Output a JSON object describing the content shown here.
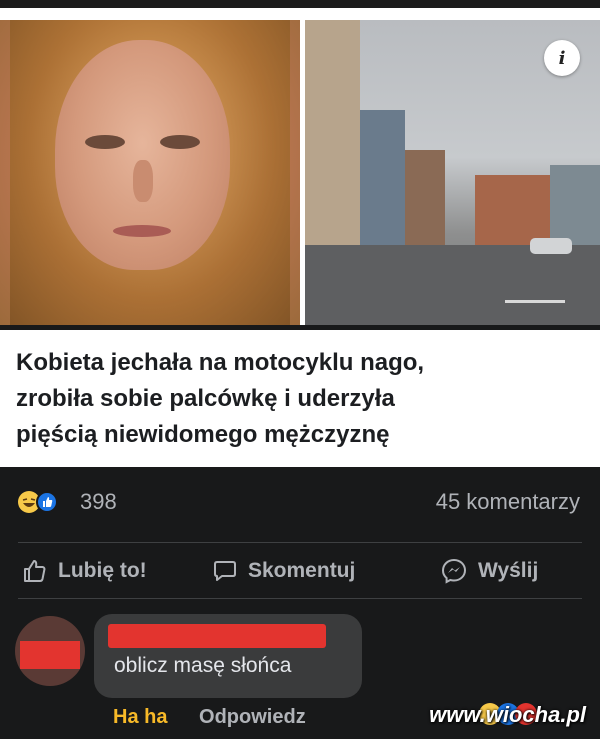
{
  "photos": {
    "info_icon": "info-icon",
    "info_label": "i"
  },
  "headline": {
    "lines": [
      "Kobieta jechała na motocyklu nago,",
      "zrobiła sobie palcówkę i uderzyła",
      "pięścią niewidomego mężczyznę"
    ]
  },
  "stats": {
    "reaction_icons": [
      "haha-icon",
      "like-icon"
    ],
    "reaction_count": "398",
    "comment_count": "45 komentarzy"
  },
  "actions": {
    "like": "Lubię to!",
    "comment": "Skomentuj",
    "send": "Wyślij"
  },
  "comment": {
    "text": "oblicz masę słońca",
    "haha_label": "Ha ha",
    "reply_label": "Odpowiedz"
  },
  "watermark": "www.wiocha.pl",
  "colors": {
    "background": "#18191a",
    "bubble": "#3a3b3c",
    "muted_text": "#b0b3b8",
    "haha_accent": "#f7b928",
    "redaction": "#e3342f"
  }
}
